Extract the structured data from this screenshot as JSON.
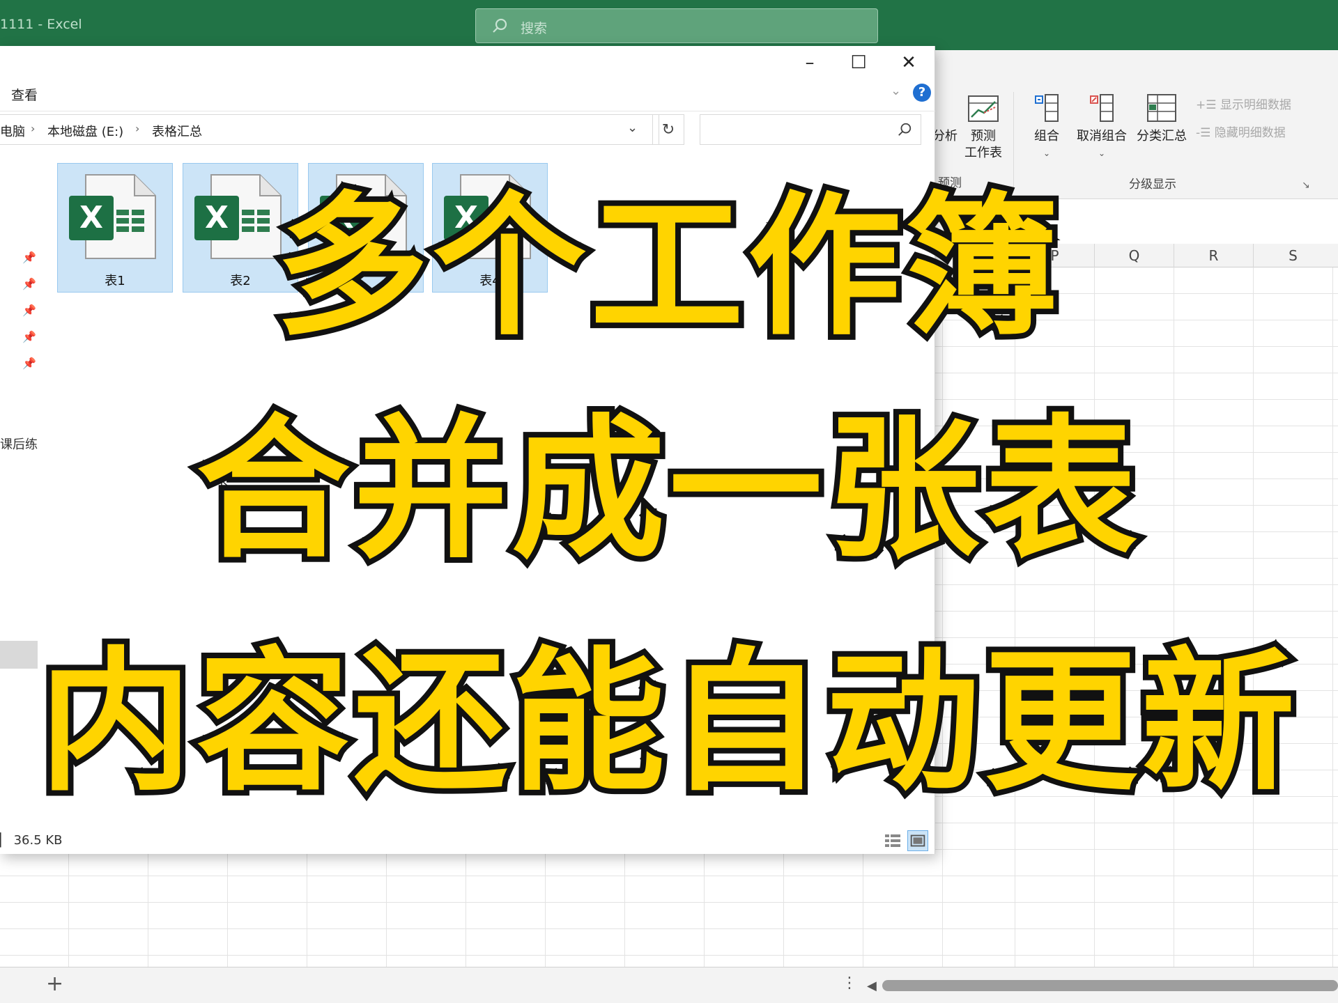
{
  "excel": {
    "window_title": "1111  -  Excel",
    "search_placeholder": "搜索",
    "ribbon": {
      "analysis_partial": "分析",
      "forecast_sheet_label": "预测\n工作表",
      "forecast_group_label": "预测",
      "group_label": "组合",
      "ungroup_label": "取消组合",
      "subtotal_label": "分类汇总",
      "show_detail_label": "显示明细数据",
      "hide_detail_label": "隐藏明细数据",
      "outline_group_label": "分级显示"
    },
    "columns": [
      "P",
      "Q",
      "R",
      "S"
    ],
    "add_sheet": "+"
  },
  "explorer": {
    "menu_view": "查看",
    "breadcrumb": [
      "电脑",
      "本地磁盘 (E:)",
      "表格汇总"
    ],
    "nav_partial_text": "课后练习",
    "files": [
      {
        "name": "表1"
      },
      {
        "name": "表2"
      },
      {
        "name": ""
      },
      {
        "name": "表4"
      }
    ],
    "status_size": "36.5 KB",
    "help": "?"
  },
  "caption": {
    "line1": "多个工作簿",
    "line2": "合并成一张表",
    "line3": "内容还能自动更新"
  },
  "colors": {
    "excel_green": "#217346",
    "caption_fill": "#ffd400",
    "caption_stroke": "#111111",
    "file_selected_bg": "#cce4f7"
  }
}
